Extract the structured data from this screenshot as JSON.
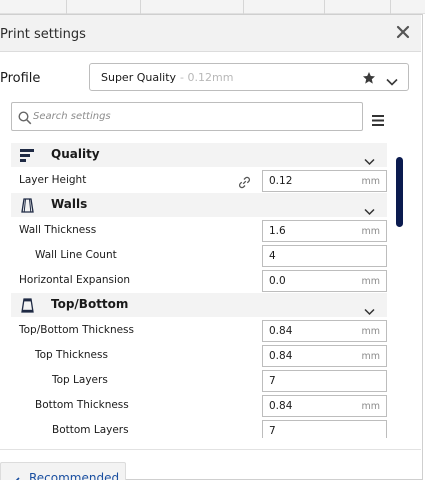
{
  "window": {
    "title": "Print settings",
    "close_icon": "close-icon"
  },
  "profile": {
    "label": "Profile",
    "name": "Super Quality",
    "detail": "- 0.12mm",
    "favorite_icon": "star-icon",
    "dropdown_icon": "chevron-down-icon"
  },
  "search": {
    "placeholder": "Search settings",
    "icon": "search-icon",
    "menu_icon": "hamburger-menu-icon"
  },
  "categories": {
    "quality": {
      "label": "Quality",
      "icon": "quality-icon"
    },
    "walls": {
      "label": "Walls",
      "icon": "walls-icon"
    },
    "topbottom": {
      "label": "Top/Bottom",
      "icon": "top-bottom-icon"
    }
  },
  "settings": {
    "layer_height": {
      "label": "Layer Height",
      "value": "0.12",
      "unit": "mm"
    },
    "wall_thickness": {
      "label": "Wall Thickness",
      "value": "1.6",
      "unit": "mm"
    },
    "wall_line_count": {
      "label": "Wall Line Count",
      "value": "4"
    },
    "horizontal_expansion": {
      "label": "Horizontal Expansion",
      "value": "0.0",
      "unit": "mm"
    },
    "topbottom_thickness": {
      "label": "Top/Bottom Thickness",
      "value": "0.84",
      "unit": "mm"
    },
    "top_thickness": {
      "label": "Top Thickness",
      "value": "0.84",
      "unit": "mm"
    },
    "top_layers": {
      "label": "Top Layers",
      "value": "7"
    },
    "bottom_thickness": {
      "label": "Bottom Thickness",
      "value": "0.84",
      "unit": "mm"
    },
    "bottom_layers": {
      "label": "Bottom Layers",
      "value": "7"
    }
  },
  "footer": {
    "recommended_label": "Recommended"
  },
  "colors": {
    "accent_link": "#1a4fa0",
    "scrollbar": "#0b1b4f",
    "category_bg": "#f3f3f3"
  }
}
